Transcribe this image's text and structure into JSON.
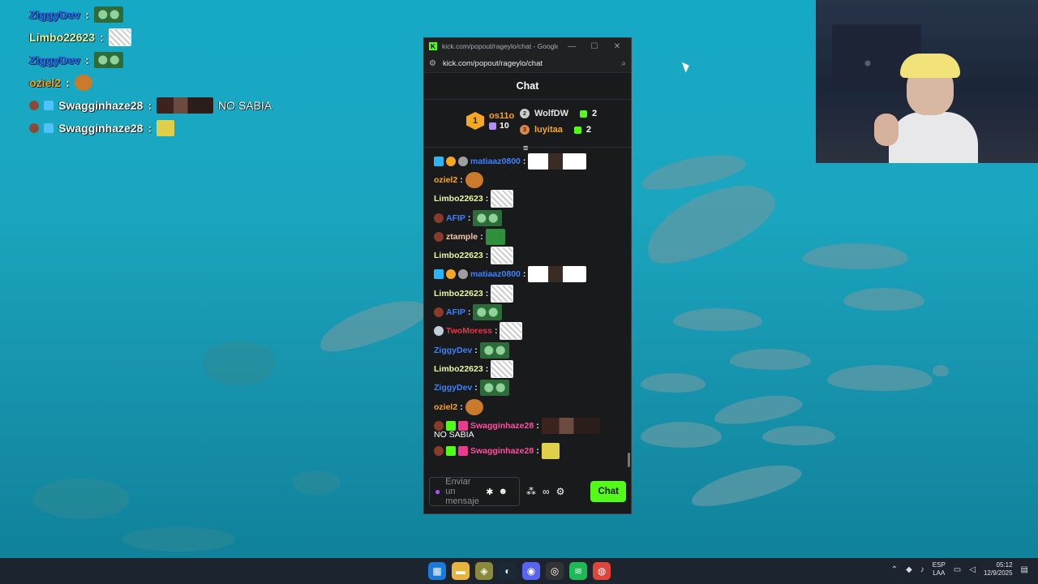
{
  "overlay_chat": [
    {
      "user": "ZiggyDev",
      "color": "#2a6cff",
      "emote": "frog",
      "text": ""
    },
    {
      "user": "Limbo22623",
      "color": "#e8f7a5",
      "emote": "cat",
      "text": ""
    },
    {
      "user": "ZiggyDev",
      "color": "#2a6cff",
      "emote": "frog",
      "text": ""
    },
    {
      "user": "oziel2",
      "color": "#f5a623",
      "emote": "bird",
      "text": ""
    },
    {
      "user": "Swagginhaze28",
      "color": "#ffffff",
      "emote": "boy2",
      "text": "NO SABIA"
    },
    {
      "user": "Swagginhaze28",
      "color": "#ffffff",
      "emote": "sponge",
      "text": ""
    }
  ],
  "browser": {
    "title": "kick.com/popout/rageylo/chat - Google...",
    "url": "kick.com/popout/rageylo/chat",
    "minimize": "—",
    "maximize": "☐",
    "close": "✕"
  },
  "chat": {
    "header": "Chat",
    "leaderboard": {
      "first": {
        "rank": "1",
        "name": "os11o",
        "count": "10"
      },
      "second": {
        "rank": "2",
        "name": "WolfDW",
        "count": "2"
      },
      "third": {
        "rank": "3",
        "name": "luyitaa",
        "count": "2"
      }
    },
    "messages": [
      {
        "user": "matiaaz0800",
        "color": "#3b82ff",
        "emote": "boy"
      },
      {
        "user": "oziel2",
        "color": "#f5a623",
        "emote": "bird"
      },
      {
        "user": "Limbo22623",
        "color": "#e8f7a5",
        "emote": "cat"
      },
      {
        "user": "AFIP",
        "color": "#3b82ff",
        "emote": "frog"
      },
      {
        "user": "ztample",
        "color": "#f5c6a5",
        "emote": "green"
      },
      {
        "user": "Limbo22623",
        "color": "#e8f7a5",
        "emote": "cat"
      },
      {
        "user": "matiaaz0800",
        "color": "#3b82ff",
        "emote": "boy"
      },
      {
        "user": "Limbo22623",
        "color": "#e8f7a5",
        "emote": "cat"
      },
      {
        "user": "AFIP",
        "color": "#3b82ff",
        "emote": "frog"
      },
      {
        "user": "TwoMoress",
        "color": "#e8324a",
        "emote": "cat"
      },
      {
        "user": "ZiggyDev",
        "color": "#3b82ff",
        "emote": "frog"
      },
      {
        "user": "Limbo22623",
        "color": "#e8f7a5",
        "emote": "cat"
      },
      {
        "user": "ZiggyDev",
        "color": "#3b82ff",
        "emote": "frog"
      },
      {
        "user": "oziel2",
        "color": "#f5a623",
        "emote": "bird"
      },
      {
        "user": "Swagginhaze28",
        "color": "#ff4fa3",
        "emote": "boy2",
        "text": "NO SABIA"
      },
      {
        "user": "Swagginhaze28",
        "color": "#ff4fa3",
        "emote": "sponge"
      }
    ],
    "colon": ":",
    "input_placeholder": "Enviar un mensaje",
    "send_button": "Chat"
  },
  "taskbar": {
    "language": "ESP",
    "language_sub": "LAA",
    "time": "05:12",
    "date": "12/9/2025"
  },
  "colors": {
    "kick_green": "#53fc18",
    "panel_bg": "#181a1b"
  }
}
